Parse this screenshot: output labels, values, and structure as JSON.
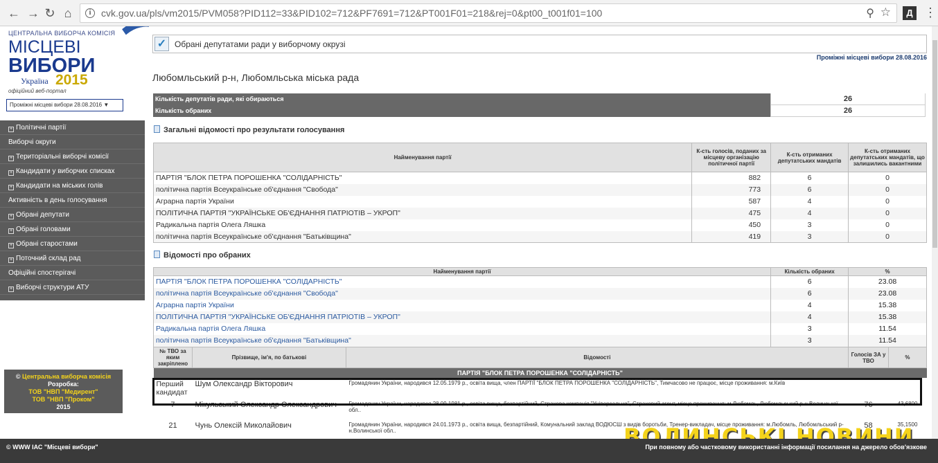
{
  "browser": {
    "url": "cvk.gov.ua/pls/vm2015/PVM058?PID112=33&PID102=712&PF7691=712&PT001F01=218&rej=0&pt00_t001f01=100",
    "extension_label": "Д"
  },
  "logo": {
    "org": "ЦЕНТРАЛЬНА ВИБОРЧА КОМІСІЯ",
    "line1": "МІСЦЕВІ",
    "line2": "ВИБОРИ",
    "country": "Україна",
    "year": "2015",
    "subtitle": "офіційний веб-портал"
  },
  "election_select": "Проміжні місцеві вибори 28.08.2016",
  "sidebar": {
    "items": [
      {
        "label": "Політичні партії",
        "expandable": true
      },
      {
        "label": "Виборчі округи",
        "expandable": false
      },
      {
        "label": "Територіальні виборчі комісії",
        "expandable": true
      },
      {
        "label": "Кандидати у виборчих списках",
        "expandable": true
      },
      {
        "label": "Кандидати на міських голів",
        "expandable": true
      },
      {
        "label": "Активність в день голосування",
        "expandable": false
      },
      {
        "label": "Обрані депутати",
        "expandable": true
      },
      {
        "label": "Обрані головами",
        "expandable": true
      },
      {
        "label": "Обрані старостами",
        "expandable": true
      },
      {
        "label": "Поточний склад рад",
        "expandable": true
      },
      {
        "label": "Офіційні спостерігачі",
        "expandable": false
      },
      {
        "label": "Виборчі структури АТУ",
        "expandable": true
      }
    ]
  },
  "copyright": {
    "line1_prefix": "©",
    "line1_org": "Центральна виборча комісія",
    "line2": "Розробка:",
    "line3": "ТОВ \"НВП \"Медирент\"",
    "line4": "ТОВ \"НВП \"Проком\"",
    "line5": "2015"
  },
  "main": {
    "header_title": "Обрані депутатами ради у виборчому окрузі",
    "election_date_link": "Проміжні місцеві вибори 28.08.2016",
    "region": "Любомльський р-н, Любомльська міська рада",
    "counts": [
      {
        "label": "Кількість депутатів ради, які обираються",
        "value": "26"
      },
      {
        "label": "Кількість обраних",
        "value": "26"
      }
    ],
    "section1_title": "Загальні відомості про результати голосування",
    "table1": {
      "headers": [
        "Найменування партії",
        "К-сть голосів, поданих за місцеву організацію політичної партії",
        "К-сть отриманих депутатських мандатів",
        "К-сть отриманих депутатських мандатів, що залишились вакантними"
      ],
      "rows": [
        [
          "ПАРТІЯ \"БЛОК ПЕТРА ПОРОШЕНКА \"СОЛІДАРНІСТЬ\"",
          "882",
          "6",
          "0"
        ],
        [
          "політична партія Всеукраїнське об'єднання \"Свобода\"",
          "773",
          "6",
          "0"
        ],
        [
          "Аграрна партія України",
          "587",
          "4",
          "0"
        ],
        [
          "ПОЛІТИЧНА ПАРТІЯ \"УКРАЇНСЬКЕ ОБ'ЄДНАННЯ ПАТРІОТІВ – УКРОП\"",
          "475",
          "4",
          "0"
        ],
        [
          "Радикальна партія Олега Ляшка",
          "450",
          "3",
          "0"
        ],
        [
          "політична партія Всеукраїнське об'єднання \"Батьківщина\"",
          "419",
          "3",
          "0"
        ]
      ]
    },
    "section2_title": "Відомості про обраних",
    "table2": {
      "headers": [
        "Найменування партії",
        "Кількість обраних",
        "%"
      ],
      "rows": [
        [
          "ПАРТІЯ \"БЛОК ПЕТРА ПОРОШЕНКА \"СОЛІДАРНІСТЬ\"",
          "6",
          "23.08"
        ],
        [
          "політична партія Всеукраїнське об'єднання \"Свобода\"",
          "6",
          "23.08"
        ],
        [
          "Аграрна партія України",
          "4",
          "15.38"
        ],
        [
          "ПОЛІТИЧНА ПАРТІЯ \"УКРАЇНСЬКЕ ОБ'ЄДНАННЯ ПАТРІОТІВ – УКРОП\"",
          "4",
          "15.38"
        ],
        [
          "Радикальна партія Олега Ляшка",
          "3",
          "11.54"
        ],
        [
          "політична партія Всеукраїнське об'єднання \"Батьківщина\"",
          "3",
          "11.54"
        ]
      ]
    },
    "table3": {
      "headers": [
        "№ ТВО за яким закріплено",
        "Прізвище, ім'я, по батькові",
        "Відомості",
        "Голосів ЗА у ТВО",
        "%"
      ],
      "party_title": "ПАРТІЯ \"БЛОК ПЕТРА ПОРОШЕНКА \"СОЛІДАРНІСТЬ\"",
      "rows": [
        [
          "Перший кандидат",
          "Шум Олександр Вікторович",
          "Громадянин України, народився 12.05.1979 р., освіта вища, член ПАРТІЇ \"БЛОК ПЕТРА ПОРОШЕНКА \"СОЛІДАРНІСТЬ\", Тимчасово не працює, місце проживання: м.Київ",
          "",
          ""
        ],
        [
          "7",
          "Мікульський Олександр Олександрович",
          "Громадянин України, народився 28.09.1981 р., освіта вища, безпартійний, Страхова компанія \"Універсальна\", Страховий агент, місце проживання: м.Любомль, Любомльський р-н.Волинської обл..",
          "76",
          "43,6800"
        ],
        [
          "21",
          "Чунь Олексій Миколайович",
          "Громадянин України, народився 24.01.1973 р., освіта вища, безпартійний, Комунальний заклад ВОДЮСШ з видів боротьби, Тренер-викладач, місце проживання: м.Любомль, Любомльський р-н.Волинської обл..",
          "58",
          "35,1500"
        ]
      ]
    }
  },
  "footer": {
    "left": "© WWW ІАС \"Місцеві вибори\"",
    "right": "При повному або частковому використанні інформації посилання на джерело обов'язкове"
  },
  "watermark": "ВОЛИНСЬКІ НОВИНИ"
}
